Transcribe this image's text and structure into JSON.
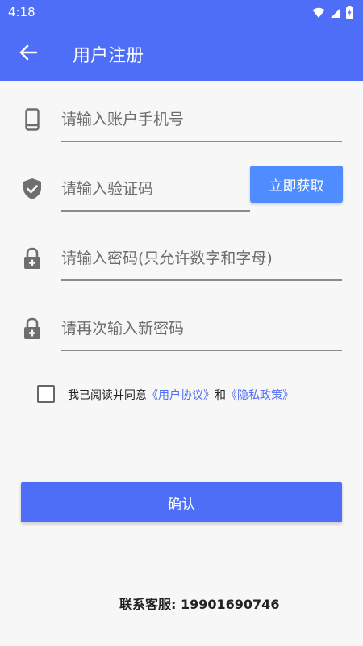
{
  "status_bar": {
    "time": "4:18"
  },
  "header": {
    "title": "用户注册",
    "back_icon": "arrow-left-icon"
  },
  "form": {
    "phone": {
      "placeholder": "请输入账户手机号",
      "icon": "smartphone-icon"
    },
    "verification": {
      "placeholder": "请输入验证码",
      "icon": "shield-check-icon",
      "button_label": "立即获取"
    },
    "password": {
      "placeholder": "请输入密码(只允许数字和字母)",
      "icon": "lock-icon"
    },
    "confirm_password": {
      "placeholder": "请再次输入新密码",
      "icon": "lock-icon"
    }
  },
  "agreement": {
    "text_prefix": "我已阅读并同意",
    "user_agreement_link": "《用户协议》",
    "and_text": "和",
    "privacy_policy_link": "《隐私政策》"
  },
  "confirm_button": "确认",
  "contact": {
    "label": "联系客服:",
    "phone": "19901690746"
  },
  "colors": {
    "primary": "#4f6ef7",
    "code_button": "#4f8cff",
    "link": "#4f6ef7",
    "background": "#f7f7f7"
  }
}
